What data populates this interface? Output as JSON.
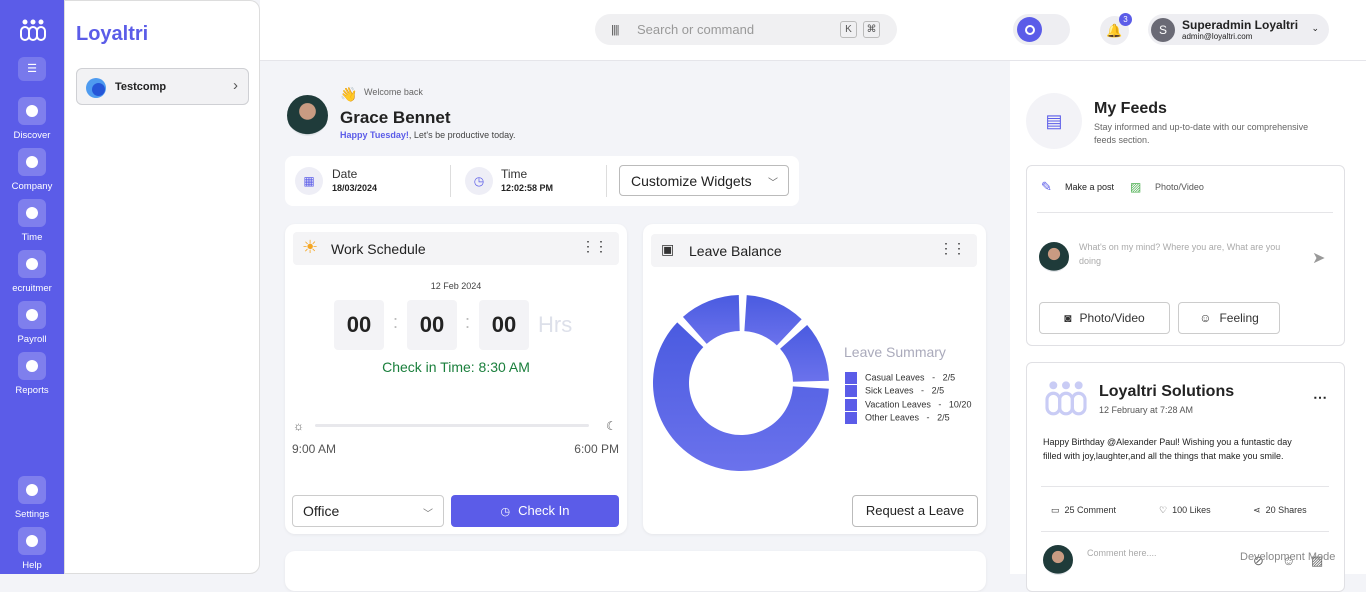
{
  "colors": {
    "accent": "#5b5ce8",
    "check_green": "#1a7f3c"
  },
  "sidebar": {
    "brand": "Loyaltri",
    "company": "Testcomp"
  },
  "rail": [
    {
      "label": "Discover",
      "icon": "compass-icon"
    },
    {
      "label": "Company",
      "icon": "building-icon"
    },
    {
      "label": "Time",
      "icon": "clock-icon"
    },
    {
      "label": "ecruitmer",
      "icon": "people-icon"
    },
    {
      "label": "Payroll",
      "icon": "dollar-icon"
    },
    {
      "label": "Reports",
      "icon": "document-icon"
    },
    {
      "label": "Settings",
      "icon": "gear-icon"
    },
    {
      "label": "Help",
      "icon": "help-icon"
    }
  ],
  "topbar": {
    "search_placeholder": "Search or command",
    "key_k": "K",
    "key_cmd": "⌘",
    "notif_count": "3",
    "user_initial": "S",
    "user_name": "Superadmin Loyaltri",
    "user_email": "admin@loyaltri.com"
  },
  "greeting": {
    "welcome": "Welcome back",
    "name": "Grace Bennet",
    "day": "Happy Tuesday!",
    "sub": ", Let's be productive today."
  },
  "datetime": {
    "date_label": "Date",
    "date": "18/03/2024",
    "time_label": "Time",
    "time": "12:02:58 PM",
    "customize": "Customize Widgets"
  },
  "work": {
    "title": "Work Schedule",
    "date": "12 Feb 2024",
    "h": "00",
    "m": "00",
    "s": "00",
    "unit": "Hrs",
    "checkin_time": "Check in Time: 8:30 AM",
    "start": "9:00 AM",
    "end": "6:00 PM",
    "location": "Office",
    "button": "Check In"
  },
  "leave": {
    "title": "Leave Balance",
    "summary": "Leave Summary",
    "items": [
      {
        "name": "Casual Leaves",
        "sep": "-",
        "val": "2/5"
      },
      {
        "name": "Sick Leaves",
        "sep": "-",
        "val": "2/5"
      },
      {
        "name": "Vacation Leaves",
        "sep": "-",
        "val": "10/20"
      },
      {
        "name": "Other Leaves",
        "sep": "-",
        "val": "2/5"
      }
    ],
    "button": "Request a Leave"
  },
  "feeds": {
    "title": "My Feeds",
    "desc1": "Stay informed and up-to-date with our comprehensive",
    "desc2": "feeds section.",
    "make_post": "Make a post",
    "photo_video_small": "Photo/Video",
    "placeholder1": "What's on my mind? Where you are, What are you",
    "placeholder2": "doing",
    "photo_video": "Photo/Video",
    "feeling": "Feeling"
  },
  "post": {
    "author": "Loyaltri Solutions",
    "time": "12 February at 7:28 AM",
    "text1": "Happy Birthday @Alexander Paul! Wishing you a funtastic day",
    "text2": "filled with joy,laughter,and all the things that make you smile.",
    "comments": "25 Comment",
    "likes": "100 Likes",
    "shares": "20 Shares",
    "comment_placeholder": "Comment here...."
  },
  "dev_mode": "Development Mode"
}
